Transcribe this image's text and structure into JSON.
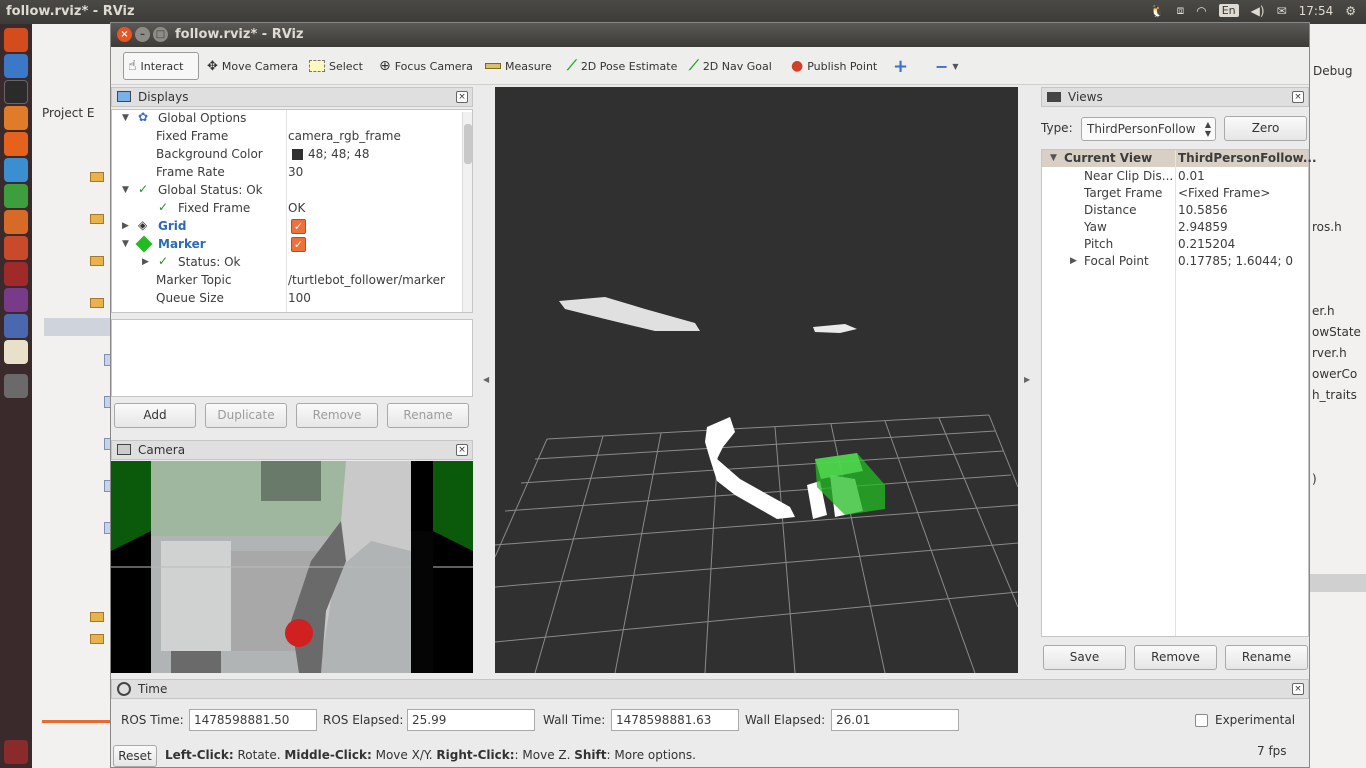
{
  "top_panel": {
    "window_title": "follow.rviz* - RViz",
    "keyboard": "En",
    "clock": "17:54"
  },
  "ide": {
    "project_label": "Project E",
    "debug_label": "Debug",
    "right_items": [
      "ros.h",
      "er.h",
      "owState",
      "rver.h",
      "owerCo",
      "h_traits",
      ")"
    ]
  },
  "window": {
    "title": "follow.rviz* - RViz"
  },
  "toolbar": {
    "tools": [
      "Interact",
      "Move Camera",
      "Select",
      "Focus Camera",
      "Measure",
      "2D Pose Estimate",
      "2D Nav Goal",
      "Publish Point"
    ],
    "plus": "+",
    "minus": "−"
  },
  "displays": {
    "title": "Displays",
    "rows": [
      {
        "name": "Global Options",
        "value": ""
      },
      {
        "name": "Fixed Frame",
        "value": "camera_rgb_frame"
      },
      {
        "name": "Background Color",
        "value": "48; 48; 48"
      },
      {
        "name": "Frame Rate",
        "value": "30"
      },
      {
        "name": "Global Status: Ok",
        "value": ""
      },
      {
        "name": "Fixed Frame",
        "value": "OK"
      },
      {
        "name": "Grid",
        "value": ""
      },
      {
        "name": "Marker",
        "value": ""
      },
      {
        "name": "Status: Ok",
        "value": ""
      },
      {
        "name": "Marker Topic",
        "value": "/turtlebot_follower/marker"
      },
      {
        "name": "Queue Size",
        "value": "100"
      }
    ],
    "buttons": {
      "add": "Add",
      "duplicate": "Duplicate",
      "remove": "Remove",
      "rename": "Rename"
    }
  },
  "camera": {
    "title": "Camera"
  },
  "views": {
    "title": "Views",
    "type_label": "Type:",
    "type_value": "ThirdPersonFollow",
    "zero": "Zero",
    "header_name": "Current View",
    "header_value": "ThirdPersonFollow...",
    "rows": [
      {
        "name": "Near Clip Dis...",
        "value": "0.01"
      },
      {
        "name": "Target Frame",
        "value": "<Fixed Frame>"
      },
      {
        "name": "Distance",
        "value": "10.5856"
      },
      {
        "name": "Yaw",
        "value": "2.94859"
      },
      {
        "name": "Pitch",
        "value": "0.215204"
      },
      {
        "name": "Focal Point",
        "value": "0.17785; 1.6044; 0"
      }
    ],
    "buttons": {
      "save": "Save",
      "remove": "Remove",
      "rename": "Rename"
    }
  },
  "time": {
    "title": "Time",
    "ros_time_label": "ROS Time:",
    "ros_time": "1478598881.50",
    "ros_elapsed_label": "ROS Elapsed:",
    "ros_elapsed": "25.99",
    "wall_time_label": "Wall Time:",
    "wall_time": "1478598881.63",
    "wall_elapsed_label": "Wall Elapsed:",
    "wall_elapsed": "26.01",
    "experimental": "Experimental"
  },
  "status": {
    "reset": "Reset",
    "help_bold1": "Left-Click:",
    "help_text1": " Rotate. ",
    "help_bold2": "Middle-Click:",
    "help_text2": " Move X/Y. ",
    "help_bold3": "Right-Click:",
    "help_text3": ": Move Z. ",
    "help_bold4": "Shift",
    "help_text4": ": More options.",
    "fps": "7 fps"
  },
  "colors": {
    "background": "#303030",
    "marker_green": "#22bb22",
    "accent_checkbox": "#f0703a"
  }
}
